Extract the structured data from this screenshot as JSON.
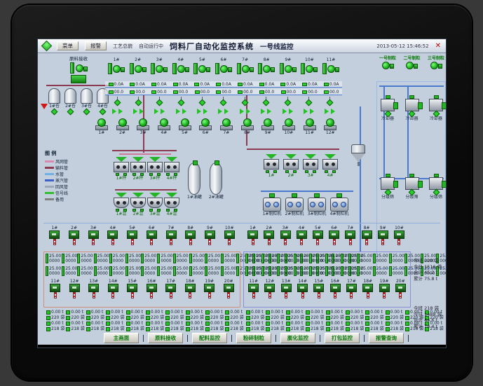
{
  "titlebar": {
    "menu_button": "菜单",
    "alarm_button": "报警",
    "label_process": "工艺总貌",
    "label_mode": "自动运行中",
    "title": "饲料厂自动化监控系统",
    "subtitle": "一号线监控",
    "datetime": "2013-05-12 15:46:52",
    "close": "✕"
  },
  "colors": {
    "accent_green": "#1fc41f",
    "pipe_material": "#8b3a52",
    "pipe_air": "#d07a9a",
    "pipe_water": "#4a7ad0",
    "box_left_border": "#cf8f7d",
    "box_right_border": "#8a90d8"
  },
  "raw_section": {
    "label": "原料接收",
    "bins": [
      {
        "tag": "1#仓"
      },
      {
        "tag": "2#仓"
      },
      {
        "tag": "3#仓"
      },
      {
        "tag": "4#仓"
      }
    ]
  },
  "top_units": [
    {
      "tag": "1#"
    },
    {
      "tag": "2#"
    },
    {
      "tag": "3#"
    },
    {
      "tag": "4#"
    },
    {
      "tag": "5#"
    },
    {
      "tag": "6#"
    },
    {
      "tag": "7#"
    },
    {
      "tag": "8#"
    },
    {
      "tag": "9#"
    },
    {
      "tag": "10#"
    },
    {
      "tag": "11#"
    }
  ],
  "strip1": [
    {
      "v": "0.0A"
    },
    {
      "v": "0.0A"
    },
    {
      "v": "0.0A"
    },
    {
      "v": "0.0A"
    },
    {
      "v": "0.0A"
    },
    {
      "v": "0.0A"
    },
    {
      "v": "0.0A"
    },
    {
      "v": "0.0A"
    },
    {
      "v": "0.0A"
    },
    {
      "v": "0.0A"
    },
    {
      "v": "0.0A"
    }
  ],
  "strip2": [
    {
      "v": "00.0"
    },
    {
      "v": "00.0"
    },
    {
      "v": "00.0"
    },
    {
      "v": "00.0"
    },
    {
      "v": "00.0"
    },
    {
      "v": "00.0"
    },
    {
      "v": "00.0"
    },
    {
      "v": "00.0"
    },
    {
      "v": "00.0"
    },
    {
      "v": "00.0"
    },
    {
      "v": "00.0"
    }
  ],
  "valve_row": [
    0,
    0,
    0,
    0,
    0,
    0,
    0,
    0,
    0,
    0,
    0
  ],
  "grinders": [
    {
      "tag": "1#"
    },
    {
      "tag": "2#"
    },
    {
      "tag": "3#"
    },
    {
      "tag": "4#"
    },
    {
      "tag": "5#"
    },
    {
      "tag": "6#"
    },
    {
      "tag": "7#"
    },
    {
      "tag": "8#"
    },
    {
      "tag": "9#"
    },
    {
      "tag": "10#"
    },
    {
      "tag": "11#"
    },
    {
      "tag": "12#"
    }
  ],
  "legend": {
    "title": "图 例",
    "items": [
      {
        "label": "风网管",
        "color": "#d98ab0"
      },
      {
        "label": "输料管",
        "color": "#8b3a52"
      },
      {
        "label": "水管",
        "color": "#6fb1e4"
      },
      {
        "label": "蒸汽管",
        "color": "#3b62c8"
      },
      {
        "label": "回风管",
        "color": "#9aa7b8"
      },
      {
        "label": "信号线",
        "color": "#2fbf2f"
      },
      {
        "label": "备用",
        "color": "#808080"
      }
    ]
  },
  "batching": {
    "scales": [
      {
        "tag": "1#秤"
      },
      {
        "tag": "2#秤"
      },
      {
        "tag": "3#秤"
      },
      {
        "tag": "4#秤"
      }
    ],
    "mixers": [
      {
        "tag": "1#混"
      },
      {
        "tag": "2#混"
      },
      {
        "tag": "3#混"
      },
      {
        "tag": "4#混"
      }
    ]
  },
  "oil_tanks": [
    {
      "tag": "1#油罐"
    },
    {
      "tag": "2#油罐"
    }
  ],
  "pelleting": {
    "bins": [
      {
        "tag": "1#"
      },
      {
        "tag": "2#"
      },
      {
        "tag": "3#"
      },
      {
        "tag": "4#"
      }
    ],
    "mills": [
      {
        "tag": "1#制粒机"
      },
      {
        "tag": "2#制粒机"
      },
      {
        "tag": "3#制粒机"
      },
      {
        "tag": "4#制粒机"
      }
    ]
  },
  "right_section": {
    "columns": [
      {
        "label": "一号制粒"
      },
      {
        "label": "二号制粒"
      },
      {
        "label": "三号制粒"
      }
    ],
    "machines_row1": [
      {
        "tag": "冷却器"
      },
      {
        "tag": "冷却器"
      },
      {
        "tag": "冷却器"
      }
    ],
    "machines_row2": [
      {
        "tag": "分级筛"
      },
      {
        "tag": "分级筛"
      },
      {
        "tag": "分级筛"
      }
    ]
  },
  "packing": {
    "left_row1": [
      {
        "tag": "1#"
      },
      {
        "tag": "2#"
      },
      {
        "tag": "3#"
      },
      {
        "tag": "4#"
      },
      {
        "tag": "5#"
      },
      {
        "tag": "6#"
      },
      {
        "tag": "7#"
      },
      {
        "tag": "8#"
      },
      {
        "tag": "9#"
      },
      {
        "tag": "10#"
      }
    ],
    "left_row2": [
      {
        "tag": "11#"
      },
      {
        "tag": "12#"
      },
      {
        "tag": "13#"
      },
      {
        "tag": "14#"
      },
      {
        "tag": "15#"
      },
      {
        "tag": "16#"
      },
      {
        "tag": "17#"
      },
      {
        "tag": "18#"
      },
      {
        "tag": "19#"
      },
      {
        "tag": "20#"
      }
    ],
    "right_row1": [
      {
        "tag": "1#"
      },
      {
        "tag": "2#"
      },
      {
        "tag": "3#"
      },
      {
        "tag": "4#"
      },
      {
        "tag": "5#"
      },
      {
        "tag": "6#"
      },
      {
        "tag": "7#"
      },
      {
        "tag": "8#"
      },
      {
        "tag": "9#"
      },
      {
        "tag": "10#"
      }
    ],
    "right_row2": [
      {
        "tag": "11#"
      },
      {
        "tag": "12#"
      },
      {
        "tag": "13#"
      },
      {
        "tag": "14#"
      },
      {
        "tag": "15#"
      },
      {
        "tag": "16#"
      },
      {
        "tag": "17#"
      },
      {
        "tag": "18#"
      },
      {
        "tag": "19#"
      },
      {
        "tag": "20#"
      }
    ],
    "readouts": [
      {
        "w1": "25.00",
        "c1": "0000",
        "w2": "25.00",
        "c2": "0000"
      },
      {
        "w1": "25.00",
        "c1": "0000",
        "w2": "25.00",
        "c2": "0000"
      },
      {
        "w1": "25.00",
        "c1": "0000",
        "w2": "25.00",
        "c2": "0000"
      },
      {
        "w1": "25.00",
        "c1": "0000",
        "w2": "25.00",
        "c2": "0000"
      },
      {
        "w1": "25.00",
        "c1": "0000",
        "w2": "25.00",
        "c2": "0000"
      },
      {
        "w1": "25.00",
        "c1": "0000",
        "w2": "25.00",
        "c2": "0000"
      },
      {
        "w1": "25.00",
        "c1": "0000",
        "w2": "25.00",
        "c2": "0000"
      },
      {
        "w1": "25.00",
        "c1": "0000",
        "w2": "25.00",
        "c2": "0000"
      },
      {
        "w1": "25.00",
        "c1": "0000",
        "w2": "25.00",
        "c2": "0000"
      },
      {
        "w1": "25.00",
        "c1": "0000",
        "w2": "25.00",
        "c2": "0000"
      }
    ],
    "counters": [
      {
        "l1": "0.00 t",
        "l2": "220 袋",
        "l3": "0.00 t",
        "l4": "218 袋"
      },
      {
        "l1": "0.00 t",
        "l2": "220 袋",
        "l3": "0.00 t",
        "l4": "218 袋"
      },
      {
        "l1": "0.00 t",
        "l2": "220 袋",
        "l3": "0.00 t",
        "l4": "218 袋"
      },
      {
        "l1": "0.00 t",
        "l2": "220 袋",
        "l3": "0.00 t",
        "l4": "218 袋"
      },
      {
        "l1": "0.00 t",
        "l2": "220 袋",
        "l3": "0.00 t",
        "l4": "218 袋"
      },
      {
        "l1": "0.00 t",
        "l2": "220 袋",
        "l3": "0.00 t",
        "l4": "218 袋"
      },
      {
        "l1": "0.00 t",
        "l2": "220 袋",
        "l3": "0.00 t",
        "l4": "218 袋"
      },
      {
        "l1": "0.00 t",
        "l2": "220 袋",
        "l3": "0.00 t",
        "l4": "218 袋"
      },
      {
        "l1": "0.00 t",
        "l2": "220 袋",
        "l3": "0.00 t",
        "l4": "218 袋"
      },
      {
        "l1": "0.00 t",
        "l2": "220 袋",
        "l3": "0.00 t",
        "l4": "218 袋"
      }
    ],
    "totals_top": [
      "今班 220 袋",
      "今日 1516 袋",
      "合计 45.2 t",
      "累计 75.8 t"
    ],
    "totals_bottom": [
      "今班 218 袋",
      "今日 1488 袋",
      "合计 44.6 t",
      "累计 74.4 t"
    ]
  },
  "buttons": [
    {
      "label": "主画面"
    },
    {
      "label": "原料接收"
    },
    {
      "label": "配料监控"
    },
    {
      "label": "粉碎制粒"
    },
    {
      "label": "膨化监控"
    },
    {
      "label": "打包监控"
    },
    {
      "label": "报警查询"
    }
  ]
}
